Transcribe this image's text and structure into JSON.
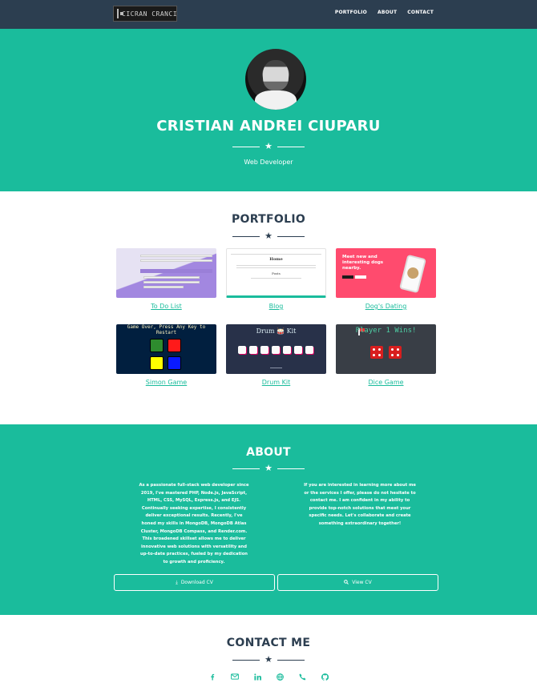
{
  "nav": {
    "logo_text": "CICRAN CRANCI",
    "links": [
      "PORTFOLIO",
      "ABOUT",
      "CONTACT"
    ]
  },
  "header": {
    "name": "CRISTIAN ANDREI CIUPARU",
    "subtitle": "Web Developer"
  },
  "portfolio": {
    "title": "PORTFOLIO",
    "items": [
      {
        "label": "To Do List"
      },
      {
        "label": "Blog",
        "thumb_heading": "Home",
        "thumb_sub": "Posts"
      },
      {
        "label": "Dog's Dating",
        "thumb_text": "Meet new and interesting dogs nearby."
      },
      {
        "label": "Simon Game",
        "thumb_text": "Game Over, Press Any Key to Restart"
      },
      {
        "label": "Drum Kit",
        "thumb_text": "Drum 🥁 Kit"
      },
      {
        "label": "Dice Game",
        "thumb_text": "Player 1 Wins!"
      }
    ]
  },
  "about": {
    "title": "ABOUT",
    "left_text": "As a passionate full-stack web developer since 2019, I've mastered PHP, Node.js, JavaScript, HTML, CSS, MySQL, Express.js, and EJS. Continually seeking expertise, I consistently deliver exceptional results. Recently, I've honed my skills in MongoDB, MongoDB Atlas Cluster, MongoDB Compass, and Render.com. This broadened skillset allows me to deliver innovative web solutions with versatility and up-to-date practices, fueled by my dedication to growth and proficiency.",
    "right_text": "If you are interested in learning more about me or the services I offer, please do not hesitate to contact me. I am confident in my ability to provide top-notch solutions that meet your specific needs. Let's collaborate and create something extraordinary together!",
    "download_cv": "Download CV",
    "view_cv": "View CV"
  },
  "contact": {
    "title": "CONTACT ME",
    "icons": [
      "facebook-icon",
      "envelope-icon",
      "linkedin-icon",
      "globe-icon",
      "phone-icon",
      "github-icon"
    ]
  },
  "colors": {
    "navy": "#2c3e50",
    "teal": "#1abc9c",
    "white": "#ffffff"
  }
}
